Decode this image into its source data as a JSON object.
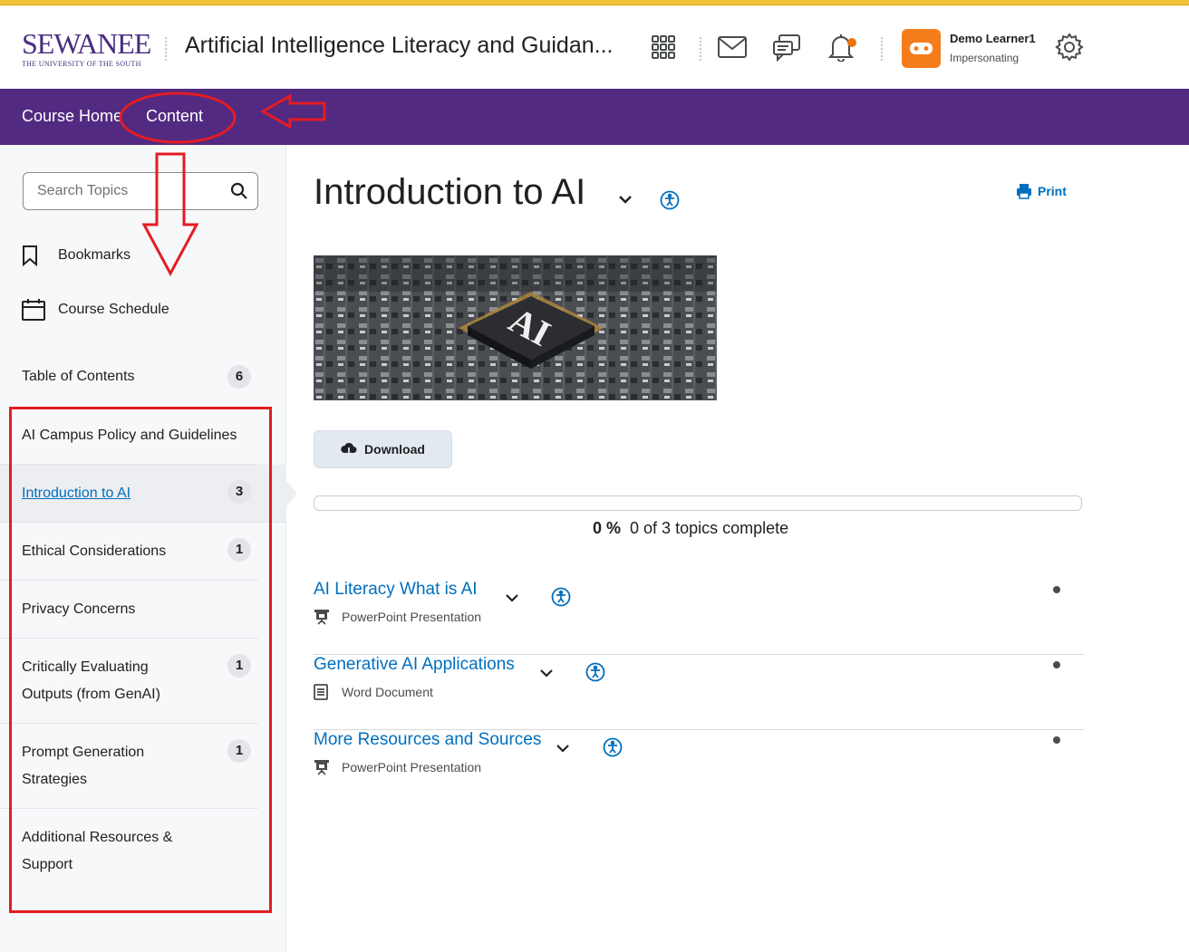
{
  "header": {
    "logo_main": "SEWANEE",
    "logo_sub": "THE UNIVERSITY OF THE SOUTH",
    "course_title": "Artificial Intelligence Literacy and Guidan...",
    "user_name": "Demo Learner1",
    "user_role": "Impersonating",
    "icons": [
      "apps-grid-icon",
      "mail-icon",
      "chat-icon",
      "bell-icon",
      "gear-icon"
    ],
    "notification_color": "#e87511",
    "avatar_color": "#f57c1b"
  },
  "nav": {
    "items": [
      {
        "label": "Course Home"
      },
      {
        "label": "Content"
      }
    ],
    "bg_color": "#522a82"
  },
  "sidebar": {
    "search_placeholder": "Search Topics",
    "bookmarks": "Bookmarks",
    "schedule": "Course Schedule",
    "toc_label": "Table of Contents",
    "toc_count": "6",
    "modules": [
      {
        "label": "AI Campus Policy and Guidelines",
        "count": ""
      },
      {
        "label": "Introduction to AI",
        "count": "3",
        "active": true
      },
      {
        "label": "Ethical Considerations",
        "count": "1"
      },
      {
        "label": "Privacy Concerns",
        "count": ""
      },
      {
        "label": "Critically Evaluating Outputs (from GenAI)",
        "count": "1"
      },
      {
        "label": "Prompt Generation Strategies",
        "count": "1"
      },
      {
        "label": "Additional Resources & Support",
        "count": ""
      }
    ]
  },
  "main": {
    "title": "Introduction to AI",
    "print_label": "Print",
    "banner_text": "AI",
    "download_label": "Download",
    "progress_percent": "0 %",
    "progress_fraction": 0,
    "progress_text": "0 of 3 topics complete",
    "topics": [
      {
        "title": "AI Literacy What is AI",
        "type": "PowerPoint Presentation",
        "icon": "presentation-icon"
      },
      {
        "title": "Generative AI Applications",
        "type": "Word Document",
        "icon": "document-icon"
      },
      {
        "title": "More Resources and Sources",
        "type": "PowerPoint Presentation",
        "icon": "presentation-icon"
      }
    ],
    "link_color": "#006fbf"
  },
  "annotations": {
    "color": "#e31c23"
  }
}
